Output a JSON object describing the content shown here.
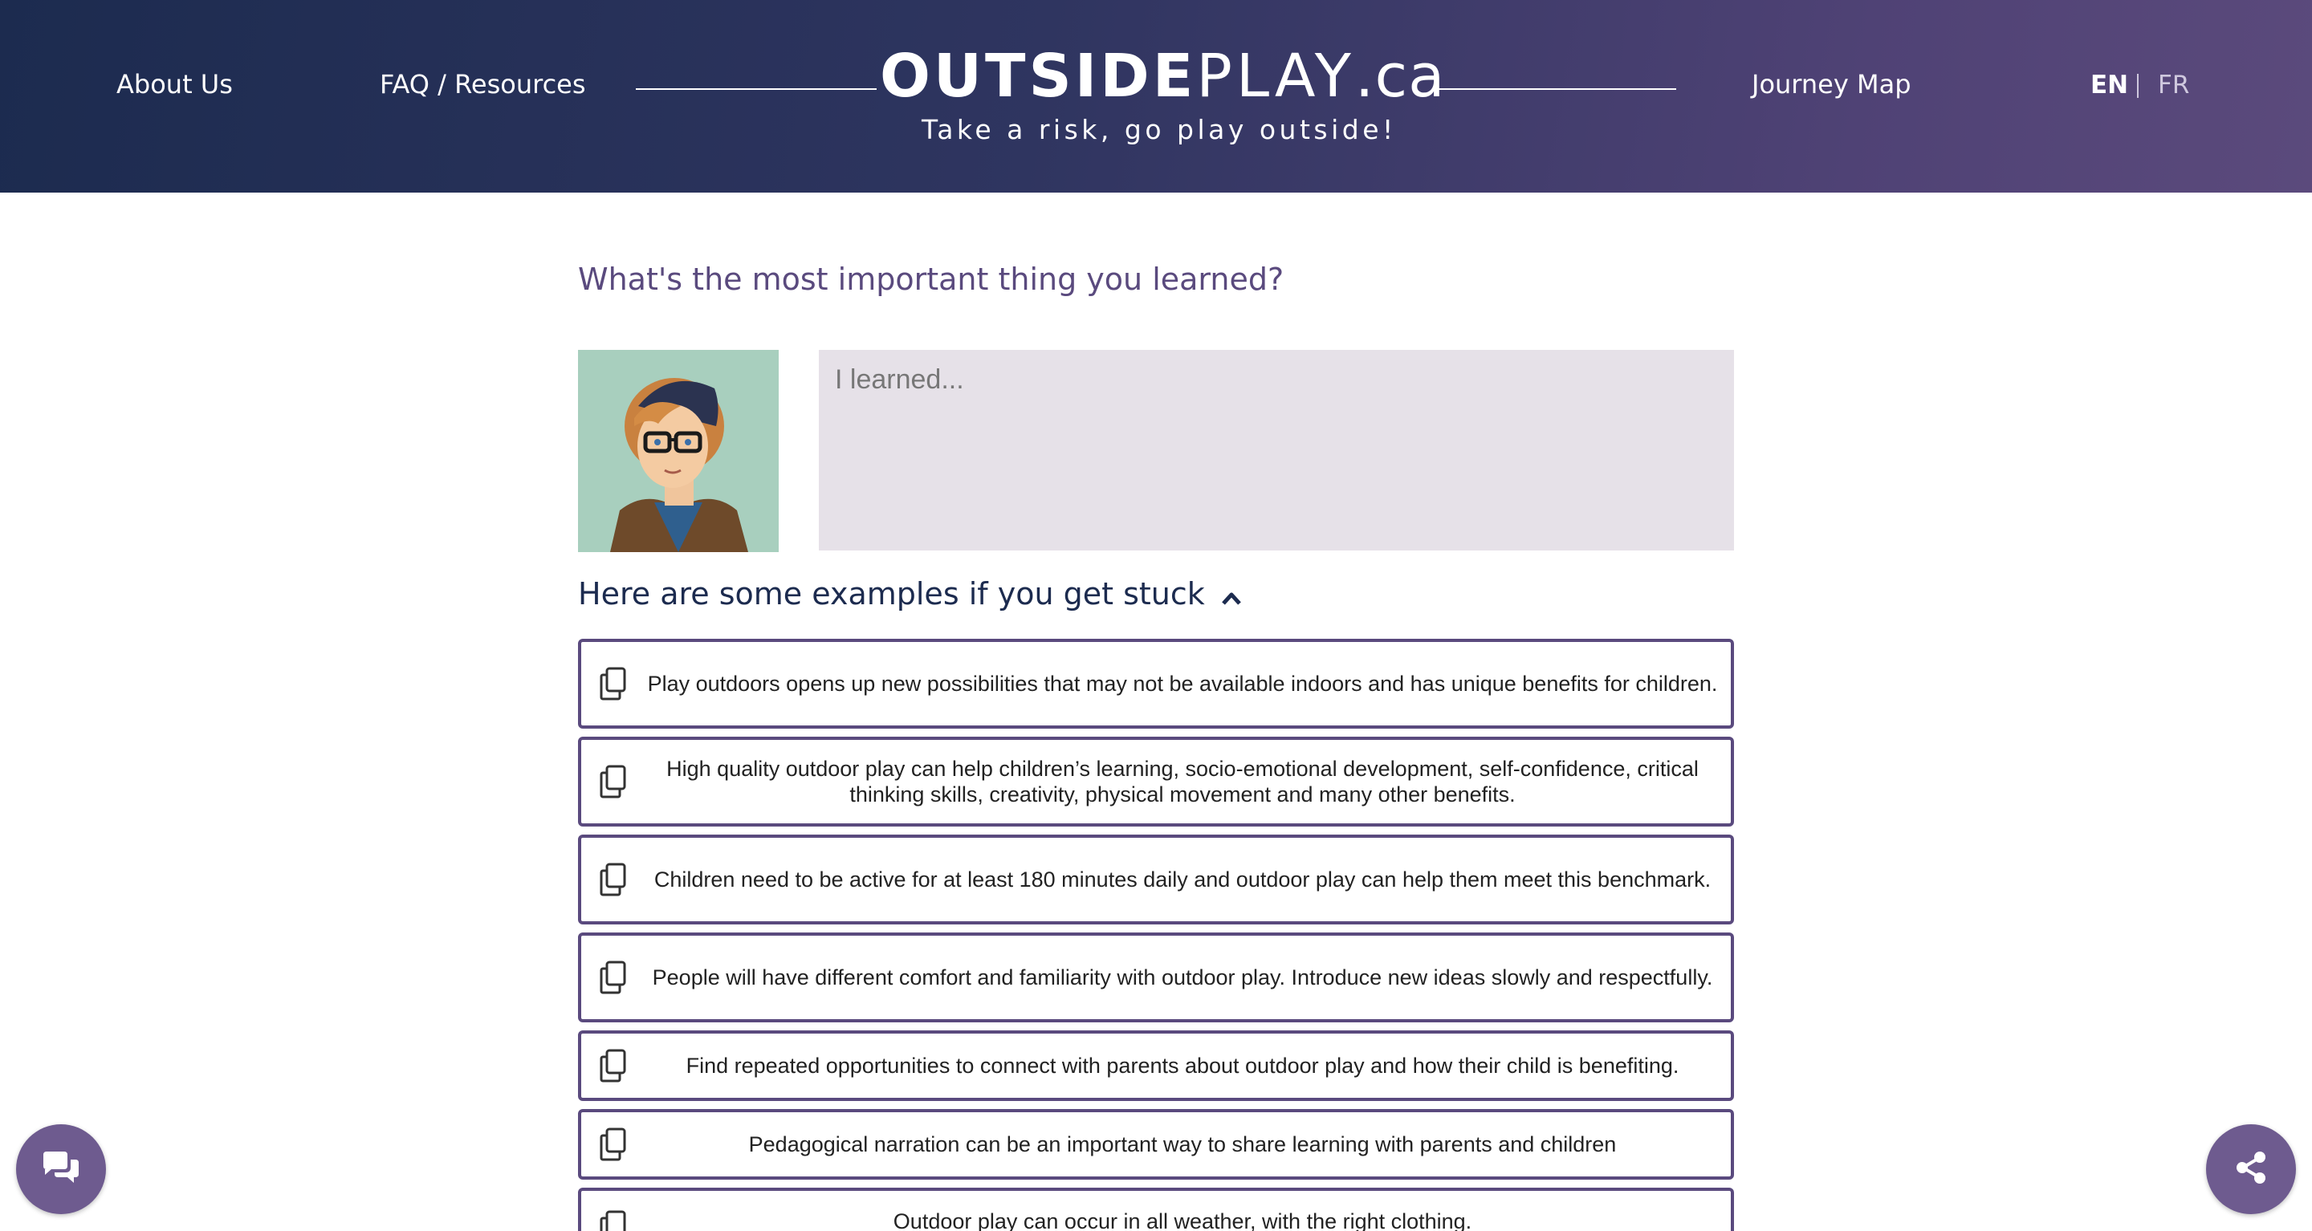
{
  "nav": {
    "about": "About Us",
    "faq": "FAQ / Resources",
    "journey": "Journey Map"
  },
  "logo": {
    "bold": "OUTSIDE",
    "light": "PLAY",
    "ext": ".ca",
    "tagline": "Take a risk, go play outside!"
  },
  "lang": {
    "en": "EN",
    "fr": "FR",
    "active": "EN"
  },
  "main": {
    "question": "What's the most important thing you learned?",
    "answer_placeholder": "I learned...",
    "examples_toggle": "Here are some examples if you get stuck",
    "examples": [
      "Play outdoors opens up new possibilities that may not be available indoors and has unique benefits for children.",
      "High quality outdoor play can help children’s learning, socio-emotional development, self-confidence, critical thinking skills, creativity, physical movement and many other benefits.",
      "Children need to be active for at least 180 minutes daily and outdoor play can help them meet this benchmark.",
      "People will have different comfort and familiarity with outdoor play. Introduce new ideas slowly and respectfully.",
      "Find repeated opportunities to connect with parents about outdoor play and how their child is benefiting.",
      "Pedagogical narration can be an important way to share learning with parents and children",
      "Outdoor play can occur in all weather, with the right clothing."
    ]
  },
  "icons": {
    "copy": "copy-icon",
    "chat": "chat-icon",
    "share": "share-icon",
    "chevron": "chevron-up-icon"
  },
  "colors": {
    "header_start": "#1c2b4f",
    "header_end": "#5b4a7c",
    "accent_purple": "#5a4a7e",
    "answer_bg": "#e6e1e8",
    "fab": "#6e5b8f"
  }
}
